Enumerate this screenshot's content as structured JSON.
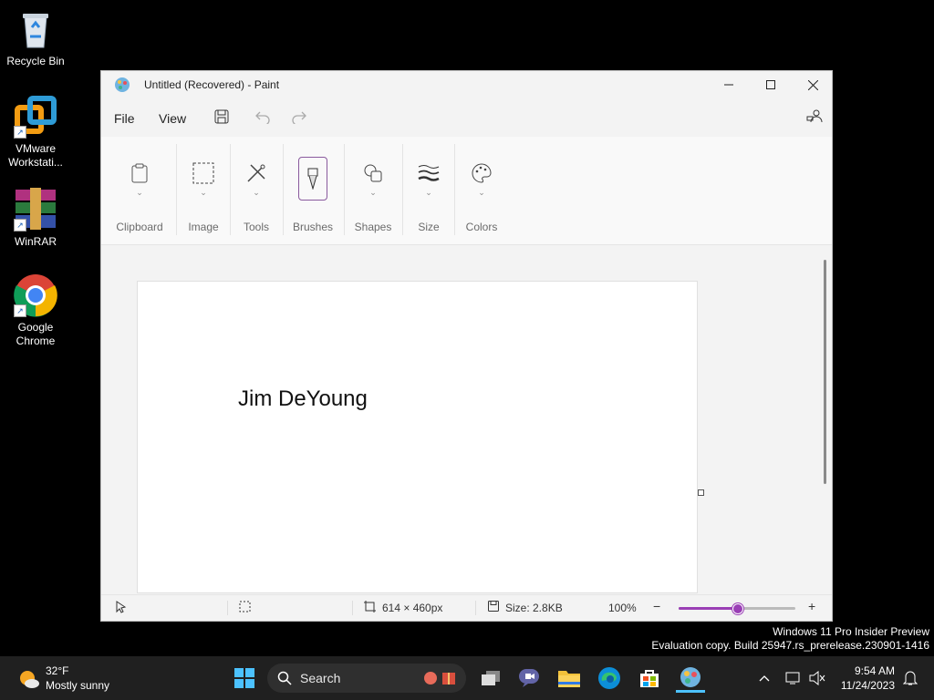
{
  "desktop": {
    "icons": [
      {
        "label": "Recycle Bin",
        "icon": "recycle-bin-icon"
      },
      {
        "label": "VMware Workstati...",
        "icon": "vmware-icon"
      },
      {
        "label": "WinRAR",
        "icon": "winrar-icon"
      },
      {
        "label": "Google Chrome",
        "icon": "chrome-icon"
      }
    ]
  },
  "window": {
    "title": "Untitled (Recovered) - Paint",
    "menu": {
      "file": "File",
      "view": "View"
    },
    "ribbon": {
      "groups": [
        {
          "label": "Clipboard",
          "icon": "clipboard-icon"
        },
        {
          "label": "Image",
          "icon": "selection-icon"
        },
        {
          "label": "Tools",
          "icon": "tools-icon"
        },
        {
          "label": "Brushes",
          "icon": "brush-icon"
        },
        {
          "label": "Shapes",
          "icon": "shapes-icon"
        },
        {
          "label": "Size",
          "icon": "size-icon"
        },
        {
          "label": "Colors",
          "icon": "palette-icon"
        }
      ]
    },
    "canvas": {
      "text": "Jim DeYoung"
    },
    "status": {
      "dimensions": "614 × 460px",
      "size": "Size: 2.8KB",
      "zoom": "100%",
      "zoom_level": 0.5
    }
  },
  "watermark": {
    "line1": "Windows 11 Pro Insider Preview",
    "line2": "Evaluation copy. Build 25947.rs_prerelease.230901-1416"
  },
  "taskbar": {
    "weather": {
      "temp": "32°F",
      "condition": "Mostly sunny"
    },
    "search": {
      "placeholder": "Search"
    },
    "clock": {
      "time": "9:54 AM",
      "date": "11/24/2023"
    }
  },
  "colors": {
    "accent": "#9a3fb5",
    "taskbar": "#202020"
  }
}
